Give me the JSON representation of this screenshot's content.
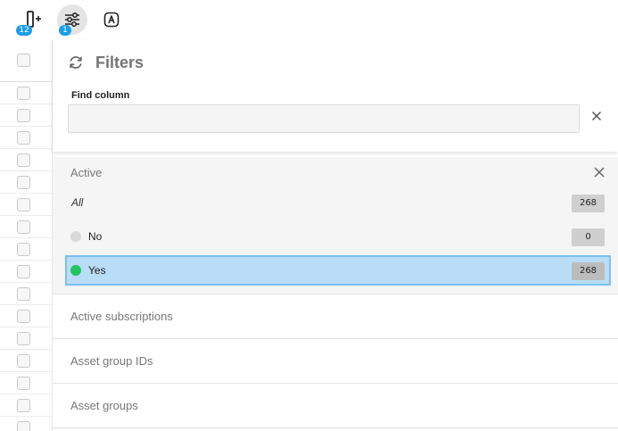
{
  "toolbar": {
    "columns_badge": "12",
    "filters_badge": "1"
  },
  "filters_panel": {
    "title": "Filters",
    "find_column_label": "Find column",
    "find_column_value": "",
    "active_filter": {
      "name": "Active",
      "options": [
        {
          "label": "All",
          "count": "268"
        },
        {
          "label": "No",
          "count": "0",
          "dot_color": "#d9d9d9"
        },
        {
          "label": "Yes",
          "count": "268",
          "dot_color": "#22c55e",
          "selected": true
        }
      ]
    },
    "sections": [
      {
        "label": "Active subscriptions"
      },
      {
        "label": "Asset group IDs"
      },
      {
        "label": "Asset groups"
      }
    ]
  },
  "colors": {
    "accent": "#1a9ee8",
    "selected_bg": "#b9dcf7",
    "selected_border": "#7cc0f0"
  }
}
